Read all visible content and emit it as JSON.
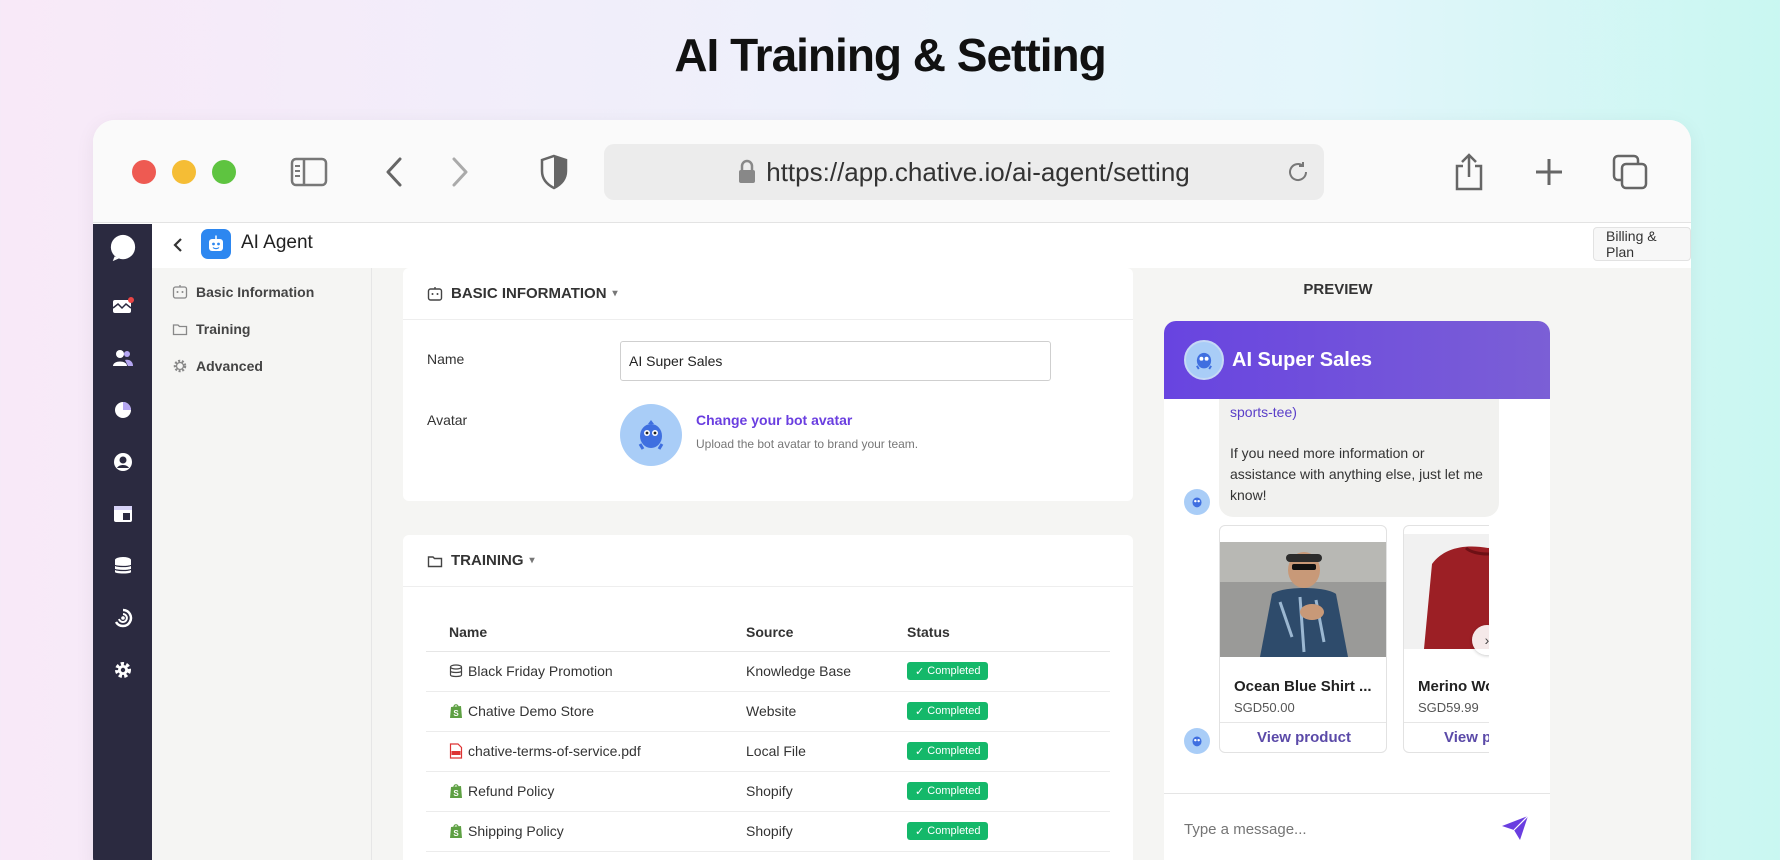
{
  "hero_title": "AI Training & Setting",
  "browser": {
    "url": "https://app.chative.io/ai-agent/setting"
  },
  "app": {
    "title": "AI Agent",
    "billing_label": "Billing & Plan"
  },
  "left_nav": [
    {
      "label": "Basic Information",
      "icon": "bot-icon"
    },
    {
      "label": "Training",
      "icon": "folder-icon"
    },
    {
      "label": "Advanced",
      "icon": "gear-icon"
    }
  ],
  "basic_info": {
    "heading": "BASIC INFORMATION",
    "name_label": "Name",
    "name_value": "AI Super Sales",
    "avatar_label": "Avatar",
    "avatar_link": "Change your bot avatar",
    "avatar_help": "Upload the bot avatar to brand your team."
  },
  "training": {
    "heading": "TRAINING",
    "columns": [
      "Name",
      "Source",
      "Status"
    ],
    "rows": [
      {
        "name": "Black Friday Promotion",
        "source": "Knowledge Base",
        "status": "Completed",
        "icon": "database-icon"
      },
      {
        "name": "Chative Demo Store",
        "source": "Website",
        "status": "Completed",
        "icon": "shopify-icon"
      },
      {
        "name": "chative-terms-of-service.pdf",
        "source": "Local File",
        "status": "Completed",
        "icon": "pdf-icon"
      },
      {
        "name": "Refund Policy",
        "source": "Shopify",
        "status": "Completed",
        "icon": "shopify-icon"
      },
      {
        "name": "Shipping Policy",
        "source": "Shopify",
        "status": "Completed",
        "icon": "shopify-icon"
      }
    ]
  },
  "preview": {
    "title": "PREVIEW",
    "bot_name": "AI Super Sales",
    "bubble_link": "sports-tee)",
    "bubble_text": "If you need more information or assistance with anything else, just let me know!",
    "products": [
      {
        "name": "Ocean Blue Shirt ...",
        "price": "SGD50.00",
        "action": "View product"
      },
      {
        "name": "Merino Wo",
        "price": "SGD59.99",
        "action": "View p"
      }
    ],
    "next_glyph": "›",
    "input_placeholder": "Type a message..."
  },
  "colors": {
    "accent": "#6a3ee0",
    "rail": "#2b2a40",
    "success": "#14b86a",
    "chat_header": "#6844e0"
  }
}
